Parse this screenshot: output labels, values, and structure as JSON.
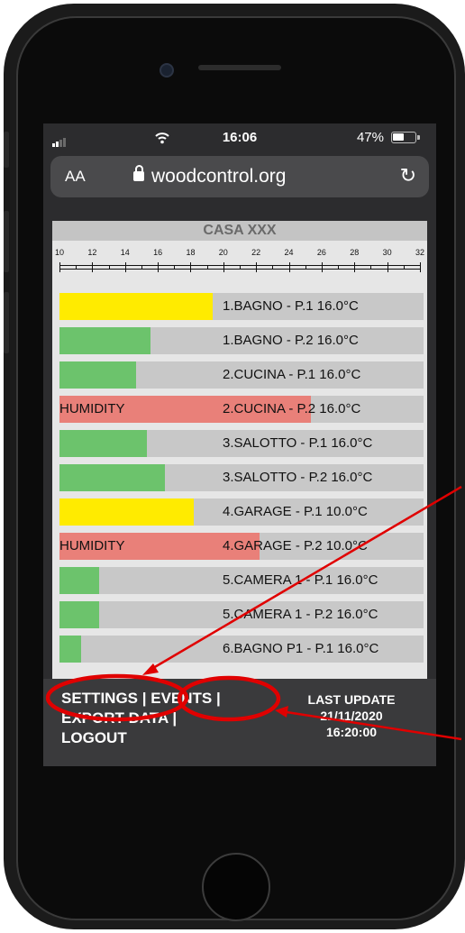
{
  "status_bar": {
    "time": "16:06",
    "battery": "47%"
  },
  "browser": {
    "aa_label": "AA",
    "url": "woodcontrol.org",
    "reload_icon": "reload-icon"
  },
  "site": {
    "title": "CASA XXX"
  },
  "scale": {
    "ticks": [
      "10",
      "12",
      "14",
      "16",
      "18",
      "20",
      "22",
      "24",
      "26",
      "28",
      "30",
      "32"
    ]
  },
  "rows": [
    {
      "label": "1.BAGNO  - P.1 16.0°C",
      "bar_label": "",
      "color": "#ffeb00",
      "fill": 0.42
    },
    {
      "label": "1.BAGNO  - P.2 16.0°C",
      "bar_label": "",
      "color": "#6cc36c",
      "fill": 0.25
    },
    {
      "label": "2.CUCINA - P.1 16.0°C",
      "bar_label": "",
      "color": "#6cc36c",
      "fill": 0.21
    },
    {
      "label": "2.CUCINA - P.2 16.0°C",
      "bar_label": "HUMIDITY",
      "color": "#e98079",
      "fill": 0.69
    },
    {
      "label": "3.SALOTTO - P.1 16.0°C",
      "bar_label": "",
      "color": "#6cc36c",
      "fill": 0.24
    },
    {
      "label": "3.SALOTTO - P.2 16.0°C",
      "bar_label": "",
      "color": "#6cc36c",
      "fill": 0.29
    },
    {
      "label": "4.GARAGE - P.1 10.0°C",
      "bar_label": "",
      "color": "#ffeb00",
      "fill": 0.37
    },
    {
      "label": "4.GARAGE - P.2 10.0°C",
      "bar_label": "HUMIDITY",
      "color": "#e98079",
      "fill": 0.55
    },
    {
      "label": "5.CAMERA 1 - P.1 16.0°C",
      "bar_label": "",
      "color": "#6cc36c",
      "fill": 0.11
    },
    {
      "label": "5.CAMERA 1 - P.2 16.0°C",
      "bar_label": "",
      "color": "#6cc36c",
      "fill": 0.11
    },
    {
      "label": "6.BAGNO P1 - P.1 16.0°C",
      "bar_label": "",
      "color": "#6cc36c",
      "fill": 0.06
    }
  ],
  "footer": {
    "settings": "SETTINGS |",
    "events": "EVENTS |",
    "export": "EXPORT DATA |",
    "logout": "LOGOUT",
    "last_update_label": "LAST UPDATE",
    "last_update_date": "21/11/2020",
    "last_update_time": "16:20:00"
  },
  "colors": {
    "accent": "#0a84ff",
    "annotation": "#e00000",
    "ok": "#6cc36c",
    "warn": "#ffeb00",
    "alarm": "#e98079"
  }
}
